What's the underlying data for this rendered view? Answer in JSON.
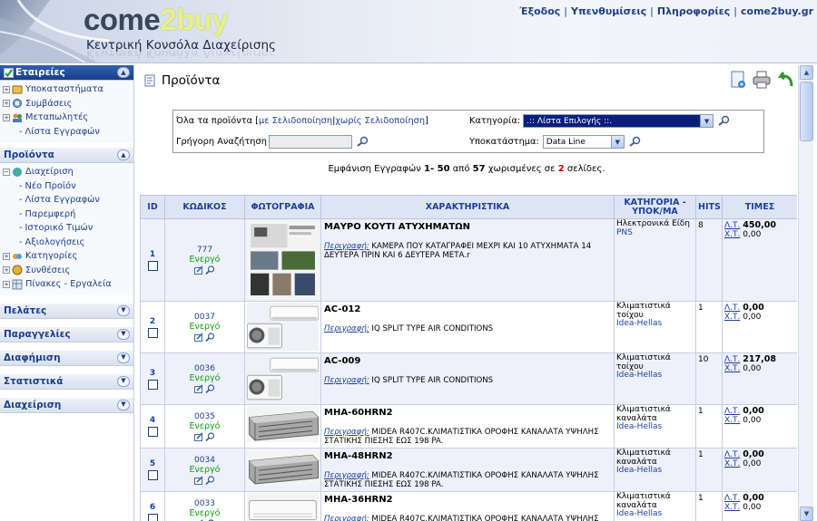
{
  "header": {
    "logo_part1": "come",
    "logo_part2": "2buy",
    "subtitle": "Κεντρική Κονσόλα Διαχείρισης",
    "links": [
      "Έξοδος",
      "Υπενθυμίσεις",
      "Πληροφορίες",
      "come2buy.gr"
    ]
  },
  "sidebar": {
    "companies": {
      "title": "Εταιρείες",
      "items": [
        {
          "label": "Υποκαταστήματα",
          "type": "tree"
        },
        {
          "label": "Συμβάσεις",
          "type": "tree"
        },
        {
          "label": "Μεταπωλητές",
          "type": "tree"
        },
        {
          "label": "Λίστα Εγγραφών",
          "type": "sub"
        }
      ]
    },
    "products": {
      "title": "Προϊόντα",
      "items": [
        {
          "label": "Διαχείριση",
          "type": "tree-open"
        },
        {
          "label": "Νέο Προϊόν",
          "type": "sub"
        },
        {
          "label": "Λίστα Εγγραφών",
          "type": "sub"
        },
        {
          "label": "Παρεμφερή",
          "type": "sub"
        },
        {
          "label": "Ιστορικό Τιμών",
          "type": "sub"
        },
        {
          "label": "Αξιολογήσεις",
          "type": "sub"
        },
        {
          "label": "Κατηγορίες",
          "type": "tree"
        },
        {
          "label": "Συνθέσεις",
          "type": "tree"
        },
        {
          "label": "Πίνακες - Εργαλεία",
          "type": "tree"
        }
      ]
    },
    "collapsed": [
      "Πελάτες",
      "Παραγγελίες",
      "Διαφήμιση",
      "Στατιστικά",
      "Διαχείριση"
    ]
  },
  "main": {
    "title": "Προϊόντα",
    "filters": {
      "all_prefix": "Όλα τα προϊόντα [",
      "with_paging": "με Σελιδοποίηση",
      "sep": " | ",
      "without_paging": "χωρίς Σελιδοποίηση",
      "all_suffix": "]",
      "quick_search_label": "Γρήγορη Αναζήτηση",
      "category_label": "Κατηγορία:",
      "category_value": ".:: Λίστα Επιλογής ::.",
      "branch_label": "Υποκατάστημα:",
      "branch_value": "Data Line"
    },
    "summary": {
      "prefix": "Εμφάνιση Εγγραφών",
      "range": "1- 50",
      "from": "από",
      "total": "57",
      "middle": "χωρισμένες σε",
      "pages": "2",
      "suffix": "σελίδες."
    },
    "columns": [
      "ID",
      "ΚΩΔΙΚΟΣ",
      "ΦΩΤΟΓΡΑΦΙΑ",
      "ΧΑΡΑΚΤΗΡΙΣΤΙΚΑ",
      "ΚΑΤΗΓΟΡΙΑ - ΥΠΟΚ/ΜΑ",
      "HITS",
      "ΤΙΜΕΣ"
    ],
    "rows": [
      {
        "id": "1",
        "code": "777",
        "status": "Ενεργό",
        "name": "ΜΑΥΡΟ ΚΟΥΤΙ ΑΤΥΧΗΜΑΤΩΝ",
        "desc_label": "Περιγραφή:",
        "desc": "ΚΑΜΕΡΑ ΠΟΥ ΚΑΤΑΓΡΑΦΕΙ ΜΕΧΡΙ ΚΑΙ 10 ΑΤΥΧΗΜΑΤΑ 14 ΔΕΥΤΕΡΑ ΠΡΙΝ ΚΑΙ 6 ΔΕΥΤΕΡΑ ΜΕΤΑ.r",
        "category": "Ηλεκτρονικά Είδη",
        "supplier": "PNS",
        "hits": "8",
        "price_label": "Λ.Τ.",
        "price": "450,00",
        "cost_label": "Χ.Τ.",
        "cost": "0,00",
        "photo": "camera"
      },
      {
        "id": "2",
        "code": "0037",
        "status": "Ενεργό",
        "name": "AC-012",
        "desc_label": "Περιγραφή:",
        "desc": "IQ SPLIT TYPE AIR CONDITIONS",
        "category": "Κλιματιστικά τοίχου",
        "supplier": "Idea-Hellas",
        "hits": "1",
        "price_label": "Λ.Τ.",
        "price": "0,00",
        "cost_label": "Χ.Τ.",
        "cost": "0,00",
        "photo": "split"
      },
      {
        "id": "3",
        "code": "0036",
        "status": "Ενεργό",
        "name": "AC-009",
        "desc_label": "Περιγραφή:",
        "desc": "IQ SPLIT TYPE AIR CONDITIONS",
        "category": "Κλιματιστικά τοίχου",
        "supplier": "Idea-Hellas",
        "hits": "10",
        "price_label": "Λ.Τ.",
        "price": "217,08",
        "cost_label": "Χ.Τ.",
        "cost": "0,00",
        "photo": "split"
      },
      {
        "id": "4",
        "code": "0035",
        "status": "Ενεργό",
        "name": "MHA-60HRN2",
        "desc_label": "Περιγραφή:",
        "desc": "MIDEA R407C.ΚΛΙΜΑΤΙΣΤΙΚΑ ΟΡΟΦΗΣ ΚΑΝΑΛΑΤΑ ΥΨΗΛΗΣ ΣΤΑΤΙΚΗΣ ΠΙΕΣΗΣ ΕΩΣ 198 PA.",
        "category": "Κλιματιστικά καναλάτα",
        "supplier": "Idea-Hellas",
        "hits": "1",
        "price_label": "Λ.Τ.",
        "price": "0,00",
        "cost_label": "Χ.Τ.",
        "cost": "0,00",
        "photo": "duct"
      },
      {
        "id": "5",
        "code": "0034",
        "status": "Ενεργό",
        "name": "MHA-48HRN2",
        "desc_label": "Περιγραφή:",
        "desc": "MIDEA R407C.ΚΛΙΜΑΤΙΣΤΙΚΑ ΟΡΟΦΗΣ ΚΑΝΑΛΑΤΑ ΥΨΗΛΗΣ ΣΤΑΤΙΚΗΣ ΠΙΕΣΗΣ ΕΩΣ 198 PA.",
        "category": "Κλιματιστικά καναλάτα",
        "supplier": "Idea-Hellas",
        "hits": "1",
        "price_label": "Λ.Τ.",
        "price": "0,00",
        "cost_label": "Χ.Τ.",
        "cost": "0,00",
        "photo": "duct"
      },
      {
        "id": "6",
        "code": "0033",
        "status": "Ενεργό",
        "name": "MHA-36HRN2",
        "desc_label": "Περιγραφή:",
        "desc": "MIDEA R407C.ΚΛΙΜΑΤΙΣΤΙΚΑ ΟΡΟΦΗΣ ΚΑΝΑΛΑΤΑ ΥΨΗΛΗΣ ΣΤΑΤΙΚΗΣ ΠΙΕΣΗΣ ΕΩΣ 198 PA.",
        "category": "Κλιματιστικά καναλάτα",
        "supplier": "Idea-Hellas",
        "hits": "1",
        "price_label": "Λ.Τ.",
        "price": "0,00",
        "cost_label": "Χ.Τ.",
        "cost": "0,00",
        "photo": "cassette"
      }
    ]
  },
  "colors": {
    "accent": "#1d3f8a",
    "status_active": "#10a010",
    "highlight": "#d00000"
  }
}
